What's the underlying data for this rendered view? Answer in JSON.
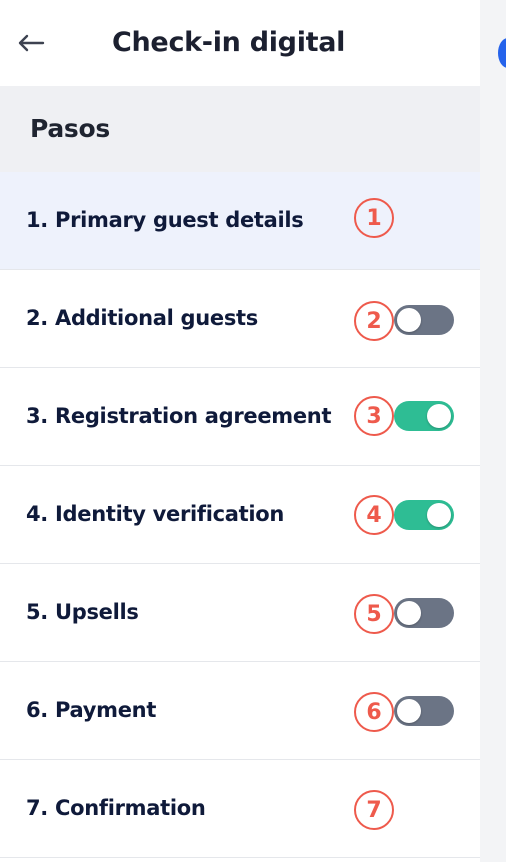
{
  "header": {
    "back_icon": "arrow-left-icon",
    "title": "Check-in digital"
  },
  "section": {
    "label": "Pasos"
  },
  "steps": [
    {
      "label": "1. Primary guest details",
      "badge": "1",
      "toggle": null,
      "active": true
    },
    {
      "label": "2. Additional guests",
      "badge": "2",
      "toggle": false,
      "active": false
    },
    {
      "label": "3. Registration agreement",
      "badge": "3",
      "toggle": true,
      "active": false
    },
    {
      "label": "4. Identity verification",
      "badge": "4",
      "toggle": true,
      "active": false
    },
    {
      "label": "5. Upsells",
      "badge": "5",
      "toggle": false,
      "active": false
    },
    {
      "label": "6. Payment",
      "badge": "6",
      "toggle": false,
      "active": false
    },
    {
      "label": "7. Confirmation",
      "badge": "7",
      "toggle": null,
      "active": false
    }
  ],
  "colors": {
    "badge": "#ee5a4c",
    "toggle_on": "#2ebd94",
    "toggle_off": "#6b7485",
    "active_row": "#eef2fc",
    "section_bg": "#eff0f3"
  }
}
